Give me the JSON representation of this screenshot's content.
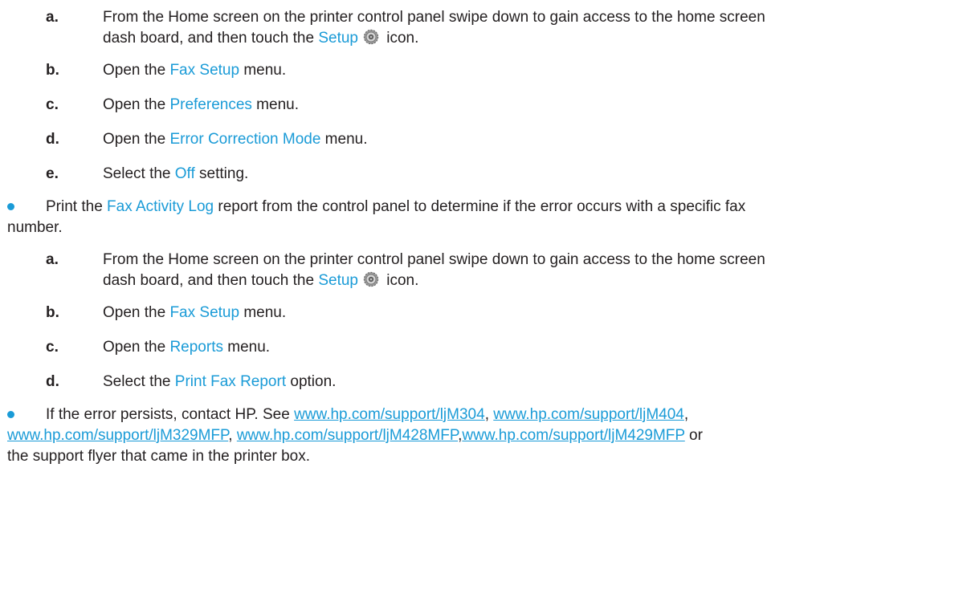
{
  "block1": {
    "steps": [
      {
        "letter": "a.",
        "pre": "From the Home screen on the printer control panel swipe down to gain access to the home screen",
        "pre2": "dash board, and then touch the ",
        "kw": "Setup",
        "post": " icon.",
        "icon": "gear-icon"
      },
      {
        "letter": "b.",
        "pre": "Open the ",
        "kw": "Fax Setup",
        "post": " menu."
      },
      {
        "letter": "c.",
        "pre": "Open the ",
        "kw": "Preferences",
        "post": " menu."
      },
      {
        "letter": "d.",
        "pre": "Open the ",
        "kw": "Error Correction Mode",
        "post": " menu."
      },
      {
        "letter": "e.",
        "pre": "Select the ",
        "kw": "Off",
        "post": " setting."
      }
    ]
  },
  "bullet1": {
    "pre": "Print the ",
    "kw": "Fax Activity Log",
    "post": " report from the control panel to determine if the error occurs with a specific fax",
    "line2": "number."
  },
  "block2": {
    "steps": [
      {
        "letter": "a.",
        "pre": "From the Home screen on the printer control panel swipe down to gain access to the home screen",
        "pre2": "dash board, and then touch the ",
        "kw": "Setup",
        "post": " icon.",
        "icon": "gear-icon"
      },
      {
        "letter": "b.",
        "pre": "Open the ",
        "kw": "Fax Setup",
        "post": " menu."
      },
      {
        "letter": "c.",
        "pre": "Open the ",
        "kw": "Reports",
        "post": " menu."
      },
      {
        "letter": "d.",
        "pre": "Select the ",
        "kw": "Print Fax Report",
        "post": " option."
      }
    ]
  },
  "bullet2": {
    "pre": "If the error persists, contact HP. See ",
    "links": [
      "www.hp.com/support/ljM304",
      "www.hp.com/support/ljM404",
      "www.hp.com/support/ljM329MFP",
      "www.hp.com/support/ljM428MFP",
      "www.hp.com/support/ljM429MFP"
    ],
    "sep": ", ",
    "sep_tight": ",",
    "or": " or",
    "line3": "the support flyer that came in the printer box."
  },
  "colors": {
    "accent": "#1a9bd7",
    "text": "#231f20"
  }
}
